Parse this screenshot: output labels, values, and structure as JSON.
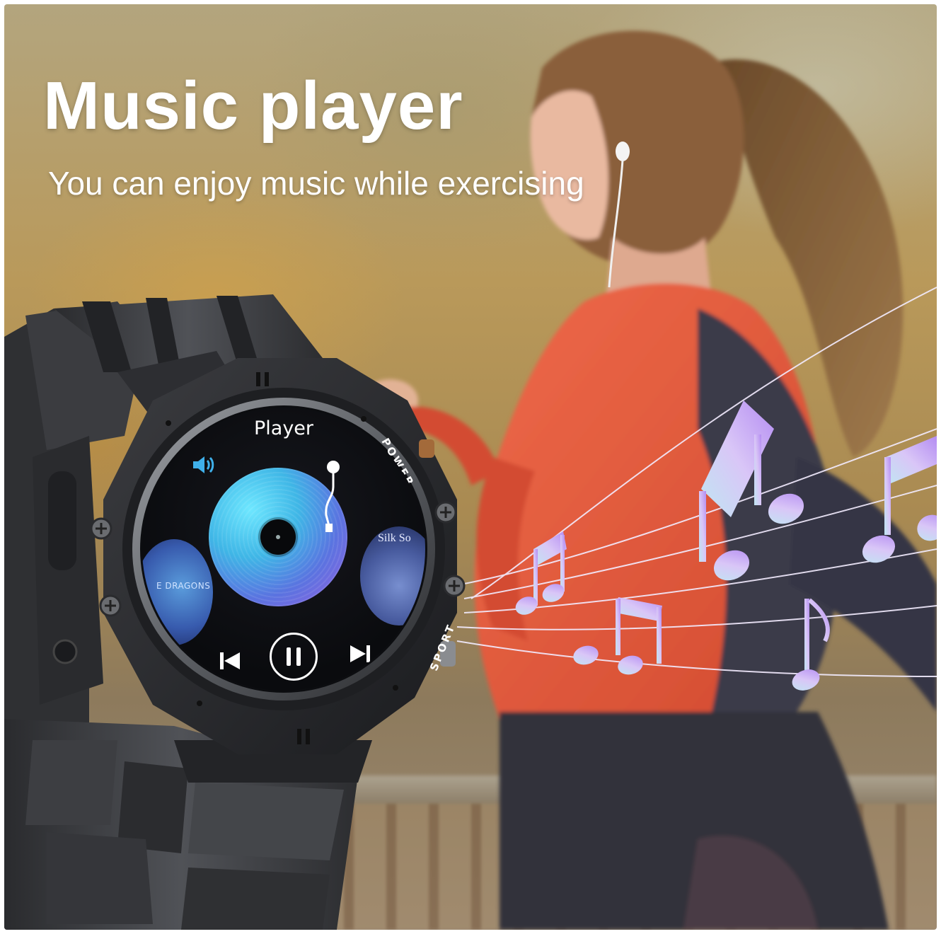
{
  "hero": {
    "title": "Music player",
    "subtitle": "You can enjoy music while exercising"
  },
  "watch_screen": {
    "title": "Player",
    "left_album_text": "E DRAGONS",
    "right_album_text": "Silk So",
    "icons": [
      "volume-icon",
      "tonearm-icon",
      "previous-track-icon",
      "pause-icon",
      "next-track-icon"
    ]
  },
  "watch_body": {
    "power_label": "POWER",
    "sport_label": "SPORT"
  },
  "colors": {
    "headline": "#ffffff",
    "disc_gradient_start": "#6ee7ff",
    "disc_gradient_end": "#9a5fe0",
    "jacket": "#e2573b",
    "notes": "#c9a6ff"
  }
}
